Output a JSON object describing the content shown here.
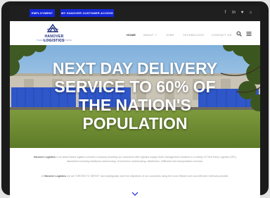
{
  "topbar": {
    "employment_label": "EMPLOYMENT",
    "portal_label": "MY HANOVER CUSTOMER ACCESS",
    "social_icons": [
      "facebook-icon",
      "linkedin-icon",
      "twitter-icon",
      "instagram-icon"
    ],
    "social_glyphs": {
      "facebook": "f",
      "linkedin": "in",
      "twitter": "♥",
      "instagram": "⌂"
    }
  },
  "brand": {
    "name": "HANOVER LOGISTICS",
    "tagline": "TRANSPORTATION SOLUTIONS",
    "color": "#1c2c7a"
  },
  "nav": {
    "items": [
      {
        "label": "HOME",
        "active": true
      },
      {
        "label": "ABOUT ˅"
      },
      {
        "label": "JOBS"
      },
      {
        "label": "TECHNOLOGY"
      },
      {
        "label": "CONTACT US"
      }
    ]
  },
  "hero": {
    "lines": [
      "NEXT DAY DELIVERY",
      "SERVICE TO 60% OF",
      "THE NATION'S",
      "POPULATION"
    ]
  },
  "intro": {
    "p1_brand": "Hanover Logistics",
    "p1_text": "is an asset based logistics services company providing our customers with logistics supply chain management solutions in a variety of Third-Party Logistics (3PL) disciplines including traditional warehousing, eCommerce warehousing, distribution, fulfillment and transportation services.",
    "p2_prefix": "At",
    "p2_brand": "Hanover Logistics",
    "p2_text": "we are \"DRIVEN TO SERVE\" and strategically meet the objectives of our customers using the most efficient and cost-effective methods possible."
  },
  "colors": {
    "accent_blue": "#1427d6",
    "topbar_bg": "#1f1f1f",
    "railcar_blue": "#2f57c9"
  }
}
